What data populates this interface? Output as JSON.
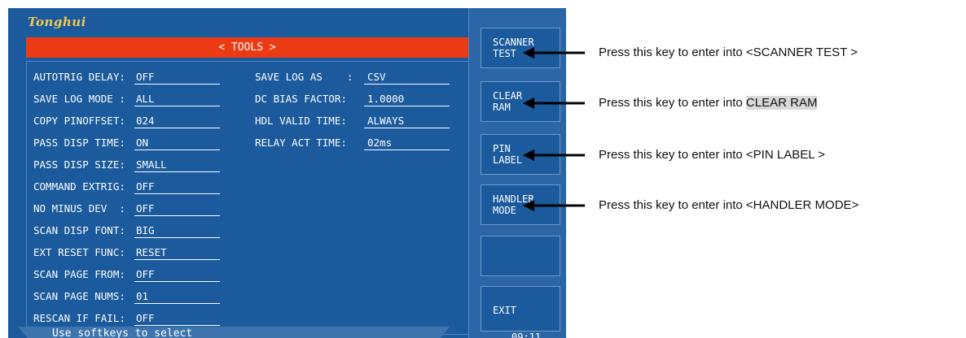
{
  "brand": "Tonghui",
  "title": "< TOOLS >",
  "status": "Use softkeys to select",
  "clock": "09:11",
  "left_settings": [
    {
      "label": "AUTOTRIG DELAY:",
      "value": "OFF"
    },
    {
      "label": "SAVE LOG MODE :",
      "value": "ALL"
    },
    {
      "label": "COPY PINOFFSET:",
      "value": "024"
    },
    {
      "label": "PASS DISP TIME:",
      "value": "ON"
    },
    {
      "label": "PASS DISP SIZE:",
      "value": "SMALL"
    },
    {
      "label": "COMMAND EXTRIG:",
      "value": "OFF"
    },
    {
      "label": "NO MINUS DEV  :",
      "value": "OFF"
    },
    {
      "label": "SCAN DISP FONT:",
      "value": "BIG"
    },
    {
      "label": "EXT RESET FUNC:",
      "value": "RESET"
    },
    {
      "label": "SCAN PAGE FROM:",
      "value": "OFF"
    },
    {
      "label": "SCAN PAGE NUMS:",
      "value": "01"
    },
    {
      "label": "RESCAN IF FAIL:",
      "value": "OFF"
    }
  ],
  "right_settings": [
    {
      "label": "SAVE LOG AS    :",
      "value": "CSV"
    },
    {
      "label": "DC BIAS FACTOR:",
      "value": "1.0000"
    },
    {
      "label": "HDL VALID TIME:",
      "value": "ALWAYS"
    },
    {
      "label": "RELAY ACT TIME:",
      "value": "02ms"
    }
  ],
  "softkeys": [
    {
      "label": "SCANNER\nTEST"
    },
    {
      "label": "CLEAR\nRAM"
    },
    {
      "label": "PIN\nLABEL"
    },
    {
      "label": "HANDLER\nMODE"
    },
    {
      "label": ""
    },
    {
      "label": "EXIT"
    }
  ],
  "captions": [
    {
      "prefix": "Press this key to enter into ",
      "target": "<SCANNER TEST >"
    },
    {
      "prefix": "Press this key to enter into ",
      "target": "CLEAR RAM"
    },
    {
      "prefix": "Press this key to enter into ",
      "target": "<PIN LABEL >"
    },
    {
      "prefix": "Press this key to enter into ",
      "target": "<HANDLER MODE>"
    }
  ],
  "colors": {
    "screen_bg": "#1b5a9c",
    "title_bar": "#ec3a15",
    "softbar": "#2d66a6",
    "brand": "#f2c94c",
    "highlight": "#d9d9d9"
  }
}
